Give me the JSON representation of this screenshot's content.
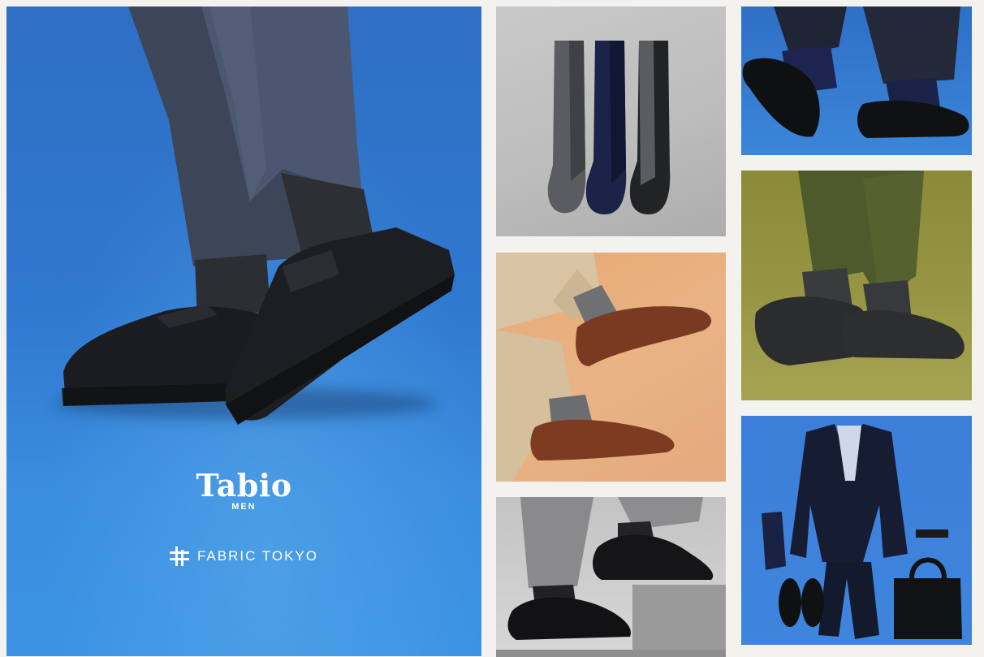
{
  "hero": {
    "brand_primary": "Tabio",
    "brand_primary_sub": "MEN",
    "brand_secondary": "FABRIC TOKYO",
    "background_color": "#2f78cf"
  },
  "tiles": [
    {
      "name": "socks-flat-lay",
      "background_color": "#c4c4c4"
    },
    {
      "name": "brown-loafers",
      "background_color": "#e8ae7f"
    },
    {
      "name": "oxford-shoes-steps",
      "background_color": "#cfcfcf"
    },
    {
      "name": "penny-loafers",
      "background_color": "#3579cd"
    },
    {
      "name": "olive-sneakers",
      "background_color": "#939241"
    },
    {
      "name": "suit-outfit-flat-lay",
      "background_color": "#3d82da"
    }
  ],
  "colors": {
    "page_background": "#f4f2ef",
    "brand_text": "#ffffff"
  }
}
